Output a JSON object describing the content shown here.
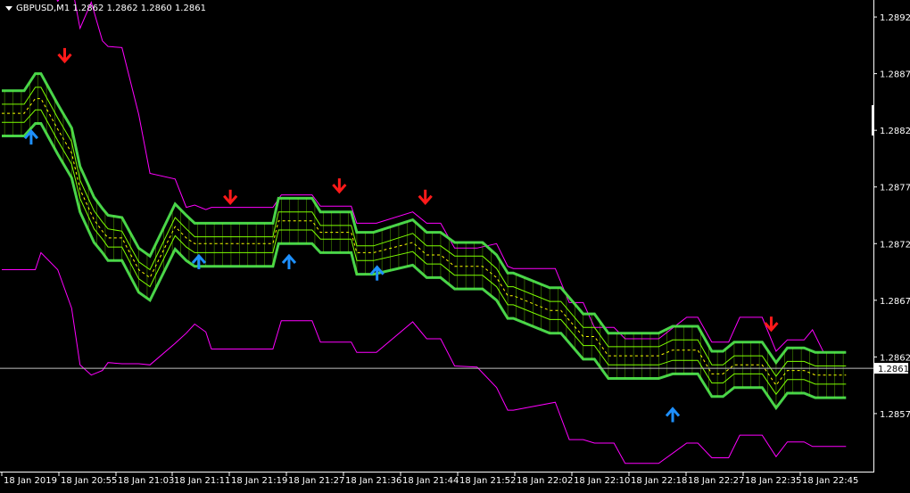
{
  "chart_window": {
    "symbol_label": "GBPUSD,M1",
    "ohlc": [
      "1.2862",
      "1.2862",
      "1.2860",
      "1.2861"
    ],
    "current_price_label": "1.2861"
  },
  "chart_data": {
    "type": "line",
    "background": "#000000",
    "price_axis": {
      "labels": [
        "1.2892",
        "1.2887",
        "1.2882",
        "1.2877",
        "1.2872",
        "1.2867",
        "1.2862",
        "1.2857"
      ],
      "values": [
        1.2892,
        1.2887,
        1.2882,
        1.2877,
        1.2872,
        1.2867,
        1.2862,
        1.2857
      ],
      "range": [
        1.28518,
        1.28935
      ]
    },
    "time_axis": {
      "labels": [
        "18 Jan 2019",
        "18 Jan 20:55",
        "18 Jan 21:03",
        "18 Jan 21:11",
        "18 Jan 21:19",
        "18 Jan 21:27",
        "18 Jan 21:36",
        "18 Jan 21:44",
        "18 Jan 21:52",
        "18 Jan 22:02",
        "18 Jan 22:10",
        "18 Jan 22:18",
        "18 Jan 22:27",
        "18 Jan 22:35",
        "18 Jan 22:45"
      ],
      "range": [
        0,
        300
      ]
    },
    "current_price": 1.2861,
    "colors": {
      "outer_band": "#ff00ff",
      "main_band": "#49d449",
      "thin_band": "#7fff00",
      "middle": "#ffff00",
      "down_arrow": "#ff1a1a",
      "up_arrow": "#1e90ff",
      "axis_text": "#ffffff",
      "current_line": "#c0c0c0"
    },
    "series": [
      {
        "role": "outer-upper",
        "x": [
          0,
          12,
          14,
          20,
          25,
          28,
          32,
          36,
          38,
          43,
          49,
          53,
          62,
          66,
          69,
          73,
          75,
          97,
          100,
          111,
          114,
          125,
          127,
          134,
          147,
          152,
          157,
          162,
          170,
          177,
          181,
          183,
          198,
          203,
          208,
          212,
          219,
          223,
          235,
          245,
          249,
          254,
          260,
          264,
          272,
          277,
          281,
          287,
          290,
          294,
          302
        ],
        "y": [
          1.28977,
          1.28977,
          1.28961,
          1.28934,
          1.28949,
          1.2891,
          1.28933,
          1.28899,
          1.28894,
          1.28893,
          1.28834,
          1.28782,
          1.28777,
          1.28752,
          1.28754,
          1.2875,
          1.28752,
          1.28752,
          1.28763,
          1.28763,
          1.28753,
          1.28753,
          1.28738,
          1.28738,
          1.28748,
          1.28738,
          1.28738,
          1.28716,
          1.28716,
          1.2872,
          1.287,
          1.28698,
          1.28698,
          1.28668,
          1.28668,
          1.28646,
          1.28646,
          1.28636,
          1.28636,
          1.28655,
          1.28655,
          1.28633,
          1.28633,
          1.28655,
          1.28655,
          1.28625,
          1.28635,
          1.28635,
          1.28644,
          1.28624,
          1.28624
        ]
      },
      {
        "role": "main-upper",
        "x": [
          0,
          8,
          12,
          14,
          20,
          25,
          28,
          33,
          36,
          38,
          43,
          49,
          53,
          62,
          66,
          69,
          72,
          97,
          99,
          111,
          114,
          125,
          127,
          133,
          147,
          152,
          157,
          162,
          172,
          177,
          181,
          183,
          196,
          200,
          208,
          212,
          217,
          220,
          235,
          240,
          249,
          254,
          258,
          262,
          272,
          277,
          281,
          287,
          291,
          296,
          302
        ],
        "y": [
          1.28855,
          1.28855,
          1.2887,
          1.2887,
          1.28843,
          1.28822,
          1.28788,
          1.28761,
          1.28751,
          1.28745,
          1.28743,
          1.28716,
          1.28709,
          1.28755,
          1.28745,
          1.28738,
          1.28738,
          1.28738,
          1.2876,
          1.2876,
          1.28748,
          1.28748,
          1.2873,
          1.2873,
          1.28741,
          1.2873,
          1.2873,
          1.28721,
          1.28721,
          1.2871,
          1.28694,
          1.28694,
          1.28681,
          1.28681,
          1.28658,
          1.28658,
          1.28641,
          1.28641,
          1.28641,
          1.28647,
          1.28647,
          1.28625,
          1.28625,
          1.28633,
          1.28633,
          1.28615,
          1.28628,
          1.28628,
          1.28624,
          1.28624,
          1.28624
        ]
      },
      {
        "role": "middle",
        "x": [
          0,
          8,
          12,
          14,
          20,
          25,
          28,
          33,
          36,
          38,
          43,
          49,
          53,
          62,
          66,
          69,
          72,
          97,
          99,
          111,
          114,
          125,
          127,
          133,
          147,
          152,
          157,
          162,
          172,
          177,
          181,
          183,
          196,
          200,
          208,
          212,
          217,
          220,
          235,
          240,
          249,
          254,
          258,
          262,
          272,
          277,
          281,
          287,
          291,
          296,
          302
        ],
        "y": [
          1.28835,
          1.28835,
          1.28848,
          1.28848,
          1.28821,
          1.288,
          1.28768,
          1.28741,
          1.28731,
          1.28725,
          1.28725,
          1.28697,
          1.2869,
          1.28735,
          1.28725,
          1.2872,
          1.2872,
          1.2872,
          1.2874,
          1.2874,
          1.2873,
          1.2873,
          1.28712,
          1.28712,
          1.28721,
          1.2871,
          1.2871,
          1.287,
          1.287,
          1.2869,
          1.28674,
          1.28674,
          1.28661,
          1.28661,
          1.28638,
          1.28638,
          1.28621,
          1.28621,
          1.28621,
          1.28626,
          1.28626,
          1.28605,
          1.28605,
          1.28613,
          1.28613,
          1.28595,
          1.28608,
          1.28608,
          1.28604,
          1.28604,
          1.28604
        ]
      },
      {
        "role": "main-lower",
        "x": [
          0,
          8,
          12,
          14,
          20,
          25,
          28,
          33,
          36,
          38,
          43,
          49,
          53,
          62,
          66,
          69,
          72,
          97,
          99,
          111,
          114,
          125,
          127,
          133,
          147,
          152,
          157,
          162,
          172,
          177,
          181,
          183,
          196,
          200,
          208,
          212,
          217,
          220,
          235,
          240,
          249,
          254,
          258,
          262,
          272,
          277,
          281,
          287,
          291,
          296,
          302
        ],
        "y": [
          1.28815,
          1.28815,
          1.28826,
          1.28826,
          1.28799,
          1.28778,
          1.28748,
          1.28721,
          1.28712,
          1.28705,
          1.28705,
          1.28677,
          1.2867,
          1.28715,
          1.28705,
          1.287,
          1.287,
          1.287,
          1.2872,
          1.2872,
          1.28712,
          1.28712,
          1.28693,
          1.28693,
          1.28701,
          1.2869,
          1.2869,
          1.2868,
          1.2868,
          1.2867,
          1.28654,
          1.28654,
          1.28641,
          1.28641,
          1.28618,
          1.28618,
          1.28601,
          1.28601,
          1.28601,
          1.28605,
          1.28605,
          1.28585,
          1.28585,
          1.28593,
          1.28593,
          1.28575,
          1.28588,
          1.28588,
          1.28584,
          1.28584,
          1.28584
        ]
      },
      {
        "role": "outer-lower",
        "x": [
          0,
          12,
          14,
          20,
          25,
          28,
          32,
          36,
          38,
          43,
          49,
          53,
          62,
          66,
          69,
          73,
          75,
          97,
          100,
          111,
          114,
          125,
          127,
          134,
          147,
          152,
          157,
          162,
          170,
          177,
          181,
          183,
          198,
          203,
          208,
          212,
          219,
          223,
          235,
          245,
          249,
          254,
          260,
          264,
          272,
          277,
          281,
          287,
          290,
          294,
          302
        ],
        "y": [
          1.28697,
          1.28697,
          1.28712,
          1.28697,
          1.28663,
          1.28613,
          1.28604,
          1.28608,
          1.28615,
          1.28614,
          1.28614,
          1.28613,
          1.28632,
          1.28641,
          1.28649,
          1.28642,
          1.28627,
          1.28627,
          1.28652,
          1.28652,
          1.28633,
          1.28633,
          1.28624,
          1.28624,
          1.28651,
          1.28636,
          1.28636,
          1.28612,
          1.28611,
          1.28593,
          1.28573,
          1.28573,
          1.2858,
          1.28547,
          1.28547,
          1.28544,
          1.28544,
          1.28526,
          1.28526,
          1.28544,
          1.28544,
          1.28531,
          1.28531,
          1.28551,
          1.28551,
          1.28532,
          1.28545,
          1.28545,
          1.28541,
          1.28541,
          1.28541
        ]
      }
    ],
    "signals": {
      "down": [
        {
          "x": 30,
          "price": 1.2888
        },
        {
          "x": 109,
          "price": 1.28755
        },
        {
          "x": 161,
          "price": 1.28765
        },
        {
          "x": 202,
          "price": 1.28755
        },
        {
          "x": 367,
          "price": 1.28643
        }
      ],
      "up": [
        {
          "x": 14,
          "price": 1.2882
        },
        {
          "x": 94,
          "price": 1.2871
        },
        {
          "x": 137,
          "price": 1.2871
        },
        {
          "x": 179,
          "price": 1.287
        },
        {
          "x": 320,
          "price": 1.28575
        }
      ]
    }
  }
}
